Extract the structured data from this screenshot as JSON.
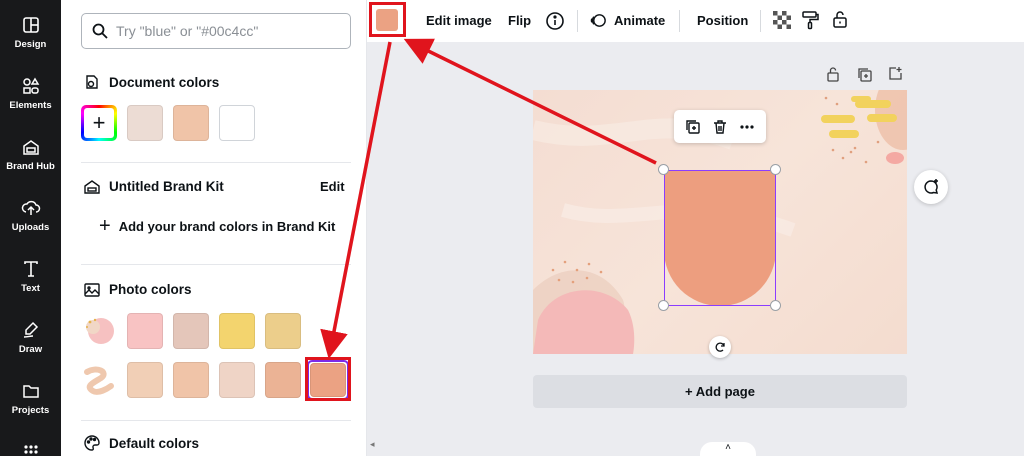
{
  "rail": {
    "items": [
      {
        "label": "Design"
      },
      {
        "label": "Elements"
      },
      {
        "label": "Brand Hub"
      },
      {
        "label": "Uploads"
      },
      {
        "label": "Text"
      },
      {
        "label": "Draw"
      },
      {
        "label": "Projects"
      }
    ]
  },
  "search": {
    "placeholder": "Try \"blue\" or \"#00c4cc\""
  },
  "document_colors": {
    "title": "Document colors",
    "swatches": [
      "#ecdcd4",
      "#f0c4a8",
      "#ffffff"
    ]
  },
  "brand_kit": {
    "title": "Untitled Brand Kit",
    "edit_label": "Edit",
    "add_label": "Add your brand colors in Brand Kit"
  },
  "photo_colors": {
    "title": "Photo colors",
    "row1": [
      "#f8c3c3",
      "#e4c6ba",
      "#f3d46e",
      "#ecce8b"
    ],
    "row2": [
      "#f1cfb6",
      "#f0c4a8",
      "#efd4c6",
      "#ebb395",
      "#eba283"
    ]
  },
  "default_colors": {
    "title": "Default colors"
  },
  "toolbar": {
    "color": "#eba283",
    "edit_image": "Edit image",
    "flip": "Flip",
    "animate": "Animate",
    "position": "Position"
  },
  "canvas": {
    "add_page": "+ Add page",
    "shape_color": "#ed9e7f"
  },
  "colors": {
    "highlight": "#e0141d",
    "selection": "#8b3dff"
  }
}
